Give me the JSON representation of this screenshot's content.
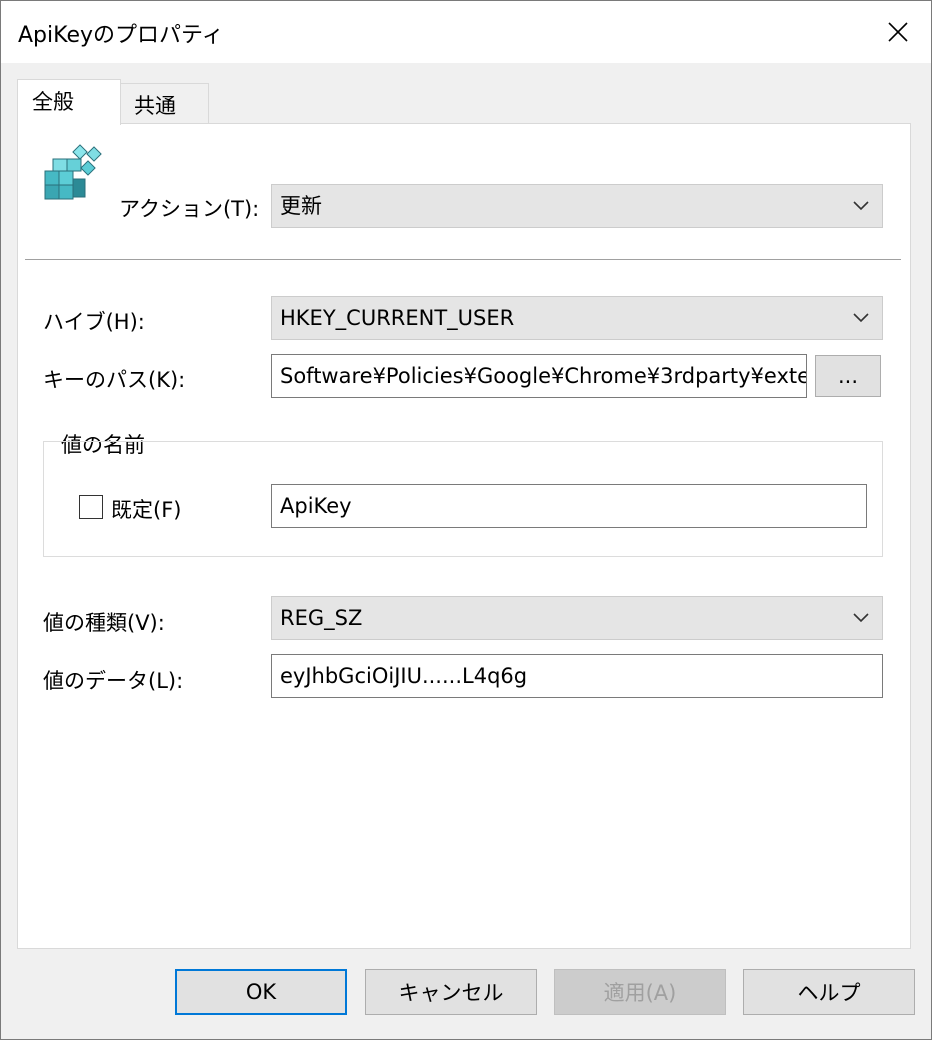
{
  "window": {
    "title": "ApiKeyのプロパティ",
    "close_icon": "close-icon"
  },
  "tabs": [
    {
      "label": "全般",
      "active": true
    },
    {
      "label": "共通",
      "active": false
    }
  ],
  "general": {
    "icon": "registry-icon",
    "action_label": "アクション(T):",
    "action_value": "更新",
    "hive_label": "ハイブ(H):",
    "hive_value": "HKEY_CURRENT_USER",
    "keypath_label": "キーのパス(K):",
    "keypath_value": "Software¥Policies¥Google¥Chrome¥3rdparty¥exte",
    "browse_label": "...",
    "value_name_group": "値の名前",
    "default_label": "既定(F)",
    "default_checked": false,
    "value_name": "ApiKey",
    "value_type_label": "値の種類(V):",
    "value_type": "REG_SZ",
    "value_data_label": "値のデータ(L):",
    "value_data": "eyJhbGciOiJIU......L4q6g"
  },
  "buttons": {
    "ok": "OK",
    "cancel": "キャンセル",
    "apply": "適用(A)",
    "help": "ヘルプ"
  }
}
